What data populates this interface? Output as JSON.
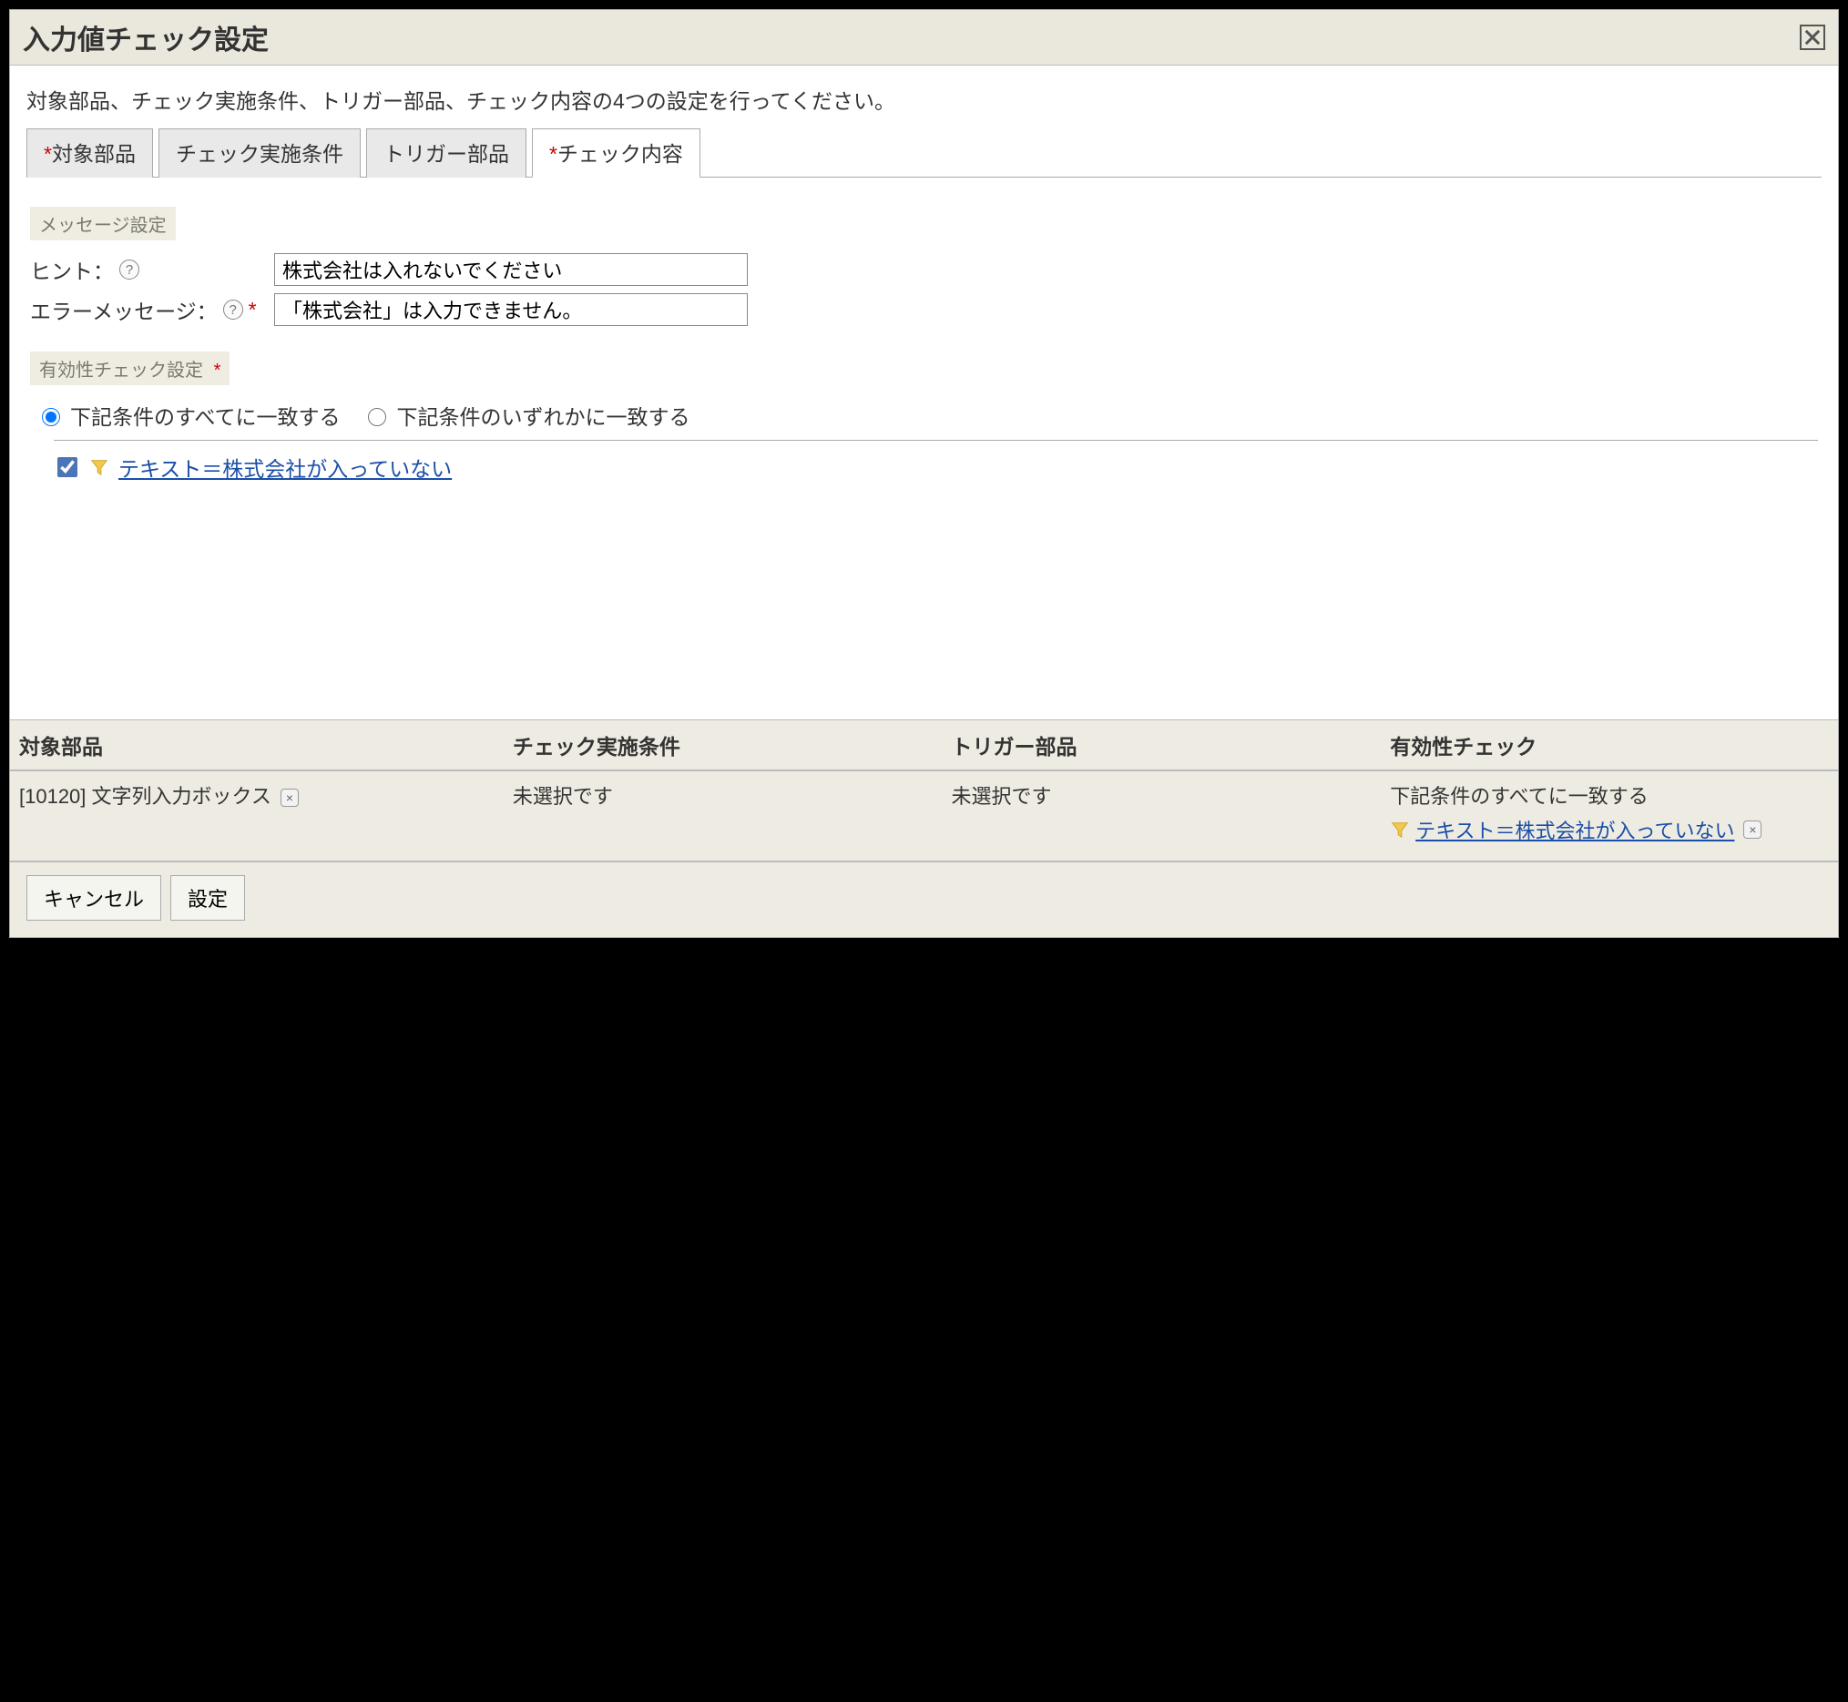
{
  "title": "入力値チェック設定",
  "intro": "対象部品、チェック実施条件、トリガー部品、チェック内容の4つの設定を行ってください。",
  "tabs": {
    "target": {
      "label": "対象部品",
      "required": true
    },
    "condition": {
      "label": "チェック実施条件",
      "required": false
    },
    "trigger": {
      "label": "トリガー部品",
      "required": false
    },
    "content": {
      "label": "チェック内容",
      "required": true
    }
  },
  "active_tab": "content",
  "message_section": {
    "legend": "メッセージ設定",
    "hint_label": "ヒント：",
    "hint_value": "株式会社は入れないでください",
    "error_label": "エラーメッセージ：",
    "error_required": "*",
    "error_value": "「株式会社」は入力できません。"
  },
  "validity_section": {
    "legend": "有効性チェック設定",
    "legend_required": "*",
    "radio_all": "下記条件のすべてに一致する",
    "radio_any": "下記条件のいずれかに一致する",
    "radio_selected": "all",
    "conditions": [
      {
        "checked": true,
        "label": "テキスト＝株式会社が入っていない"
      }
    ]
  },
  "summary": {
    "headers": {
      "target": "対象部品",
      "condition": "チェック実施条件",
      "trigger": "トリガー部品",
      "validity": "有効性チェック"
    },
    "row": {
      "target": "[10120] 文字列入力ボックス",
      "condition": "未選択です",
      "trigger": "未選択です",
      "validity_line1": "下記条件のすべてに一致する",
      "validity_cond": "テキスト＝株式会社が入っていない"
    }
  },
  "buttons": {
    "cancel": "キャンセル",
    "apply": "設定"
  }
}
